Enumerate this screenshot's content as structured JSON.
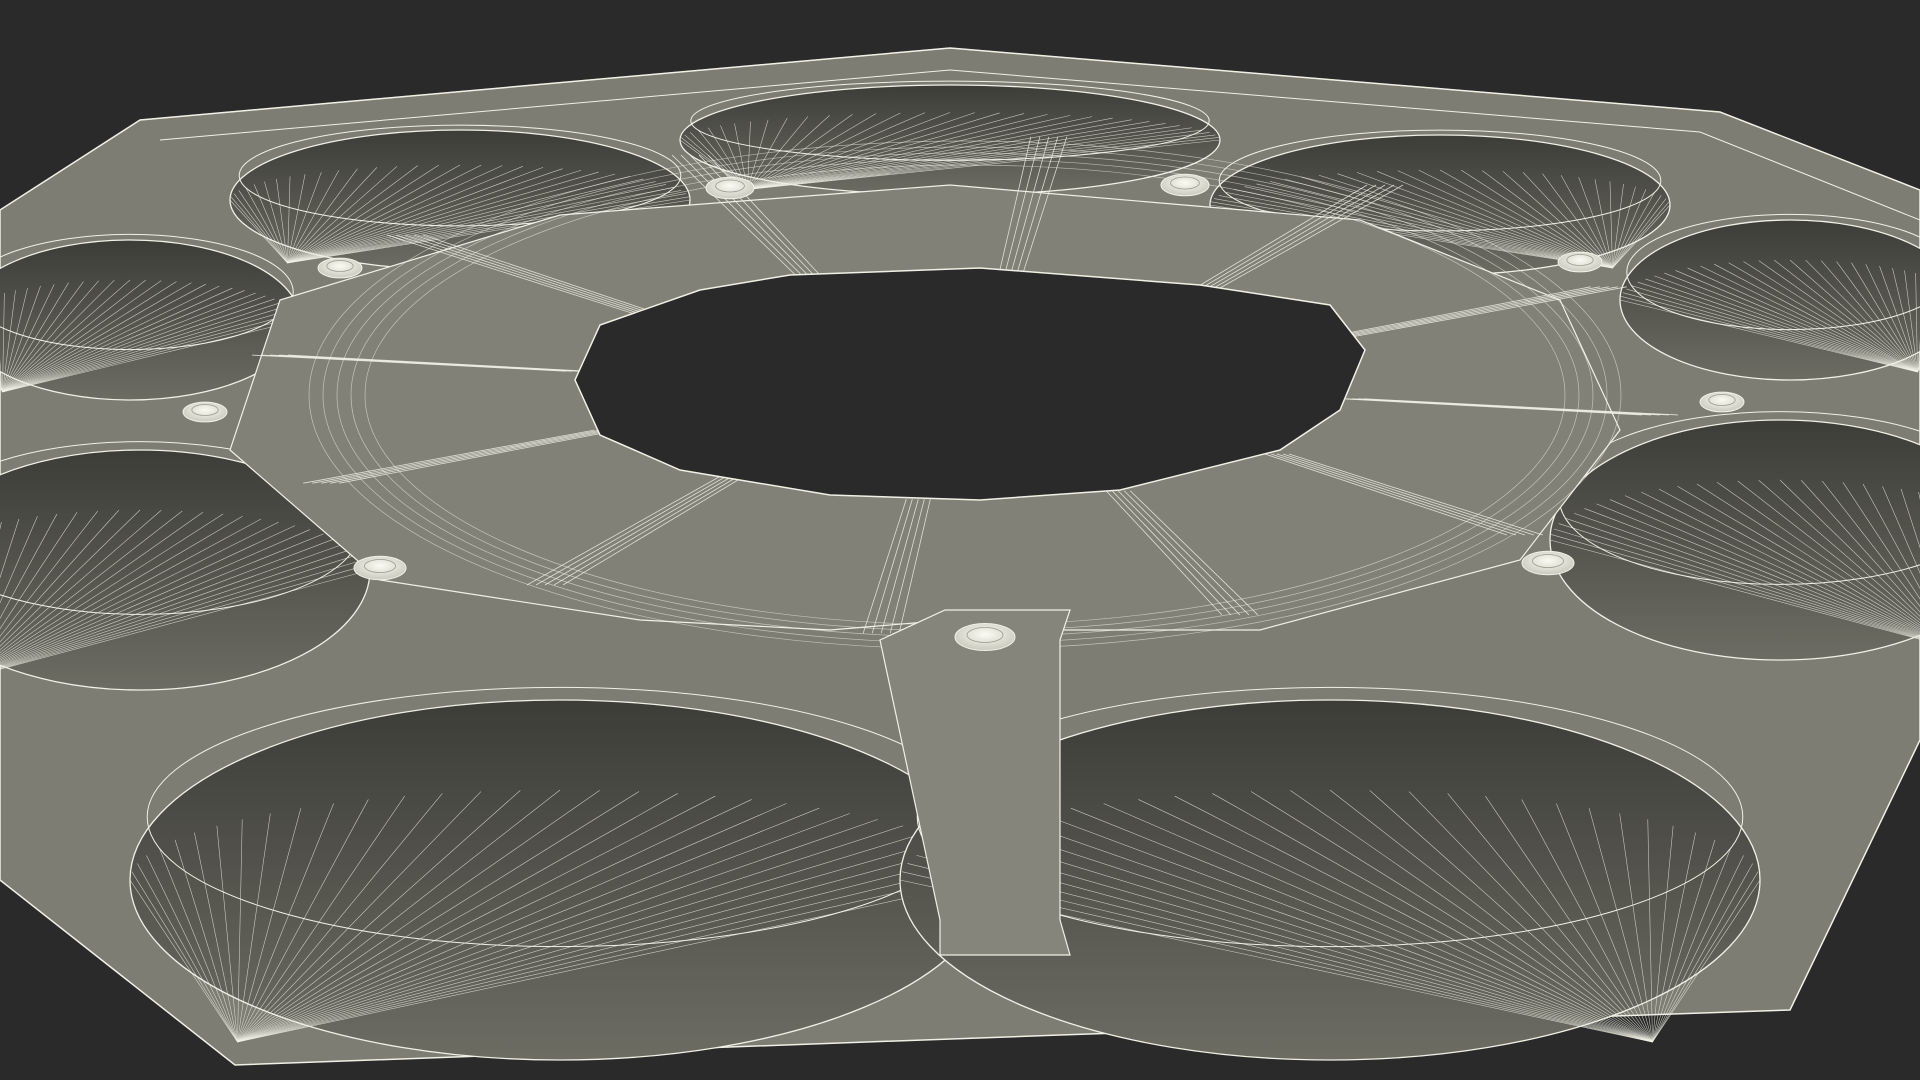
{
  "scene": {
    "subject": "wireframe-render-twelve-sided-ring-structure",
    "colors": {
      "background": "#2a2a2a",
      "surface": "#7a7a70",
      "surface_light": "#8a8a80",
      "surface_dark": "#5e5e56",
      "cavity": "#4a4a44",
      "wire": "#f0f0e6",
      "hole": "#2a2a2a"
    },
    "lobes": 12,
    "domes": 10,
    "icons": [
      "dome-icon"
    ]
  }
}
